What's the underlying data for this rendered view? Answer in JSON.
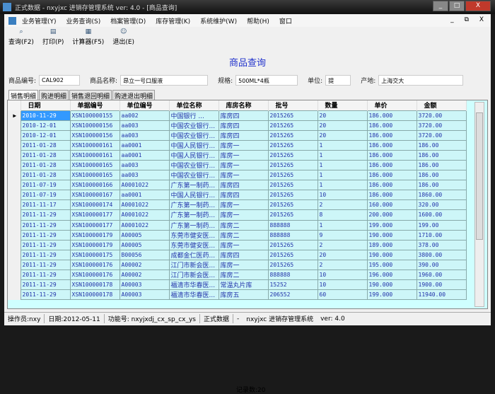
{
  "window": {
    "title": "正式数据 - nxyjxc 进销存管理系统 ver: 4.0 - [商品查询]",
    "min": "_",
    "max": "□",
    "close": "X"
  },
  "menu": [
    "业务管理(Y)",
    "业务查询(S)",
    "档案管理(D)",
    "库存管理(K)",
    "系统维护(W)",
    "帮助(H)",
    "窗口"
  ],
  "mdi_controls": "_ ⧉ X",
  "toolbar": [
    {
      "label": "查询(F2)",
      "icon": "search-icon",
      "glyph": "⌕"
    },
    {
      "label": "打印(P)",
      "icon": "printer-icon",
      "glyph": "▤"
    },
    {
      "label": "计算器(F5)",
      "icon": "calculator-icon",
      "glyph": "▦"
    },
    {
      "label": "退出(E)",
      "icon": "exit-icon",
      "glyph": "☺"
    }
  ],
  "page_title": "商品查询",
  "fields": [
    {
      "label": "商品编号:",
      "value": "CAL902"
    },
    {
      "label": "商品名称:",
      "value": "昂立一号口服液"
    },
    {
      "label": "规格:",
      "value": "500ML*4瓶"
    },
    {
      "label": "单位:",
      "value": "提"
    },
    {
      "label": "产地:",
      "value": "上海交大"
    }
  ],
  "tabs": [
    "销售明细",
    "购进明细",
    "销售退回明细",
    "购进退出明细"
  ],
  "columns": [
    "日期",
    "单据编号",
    "单位编号",
    "单位名称",
    "库房名称",
    "批号",
    "数量",
    "单价",
    "金额"
  ],
  "rows": [
    [
      "2010-11-29",
      "XSN100000155",
      "aa002",
      "中国银行      ...",
      "库房四",
      "2015265",
      "20",
      "186.000",
      "3720.00"
    ],
    [
      "2010-12-01",
      "XSN100000156",
      "aa003",
      "中国农业银行...",
      "库房四",
      "2015265",
      "20",
      "186.000",
      "3720.00"
    ],
    [
      "2010-12-01",
      "XSN100000156",
      "aa003",
      "中国农业银行...",
      "库房四",
      "2015265",
      "20",
      "186.000",
      "3720.00"
    ],
    [
      "2011-01-28",
      "XSN100000161",
      "aa0001",
      "中国人民银行...",
      "库房一",
      "2015265",
      "1",
      "186.000",
      "186.00"
    ],
    [
      "2011-01-28",
      "XSN100000161",
      "aa0001",
      "中国人民银行...",
      "库房一",
      "2015265",
      "1",
      "186.000",
      "186.00"
    ],
    [
      "2011-01-28",
      "XSN100000165",
      "aa003",
      "中国农业银行...",
      "库房一",
      "2015265",
      "1",
      "186.000",
      "186.00"
    ],
    [
      "2011-01-28",
      "XSN100000165",
      "aa003",
      "中国农业银行...",
      "库房一",
      "2015265",
      "1",
      "186.000",
      "186.00"
    ],
    [
      "2011-07-19",
      "XSN100000166",
      "A0001022",
      "广东第一制药...",
      "库房四",
      "2015265",
      "1",
      "186.000",
      "186.00"
    ],
    [
      "2011-07-19",
      "XSN100000167",
      "aa0001",
      "中国人民银行...",
      "库房四",
      "2015265",
      "10",
      "186.000",
      "1860.00"
    ],
    [
      "2011-11-17",
      "XSN100000174",
      "A0001022",
      "广东第一制药...",
      "库房一",
      "2015265",
      "2",
      "160.000",
      "320.00"
    ],
    [
      "2011-11-29",
      "XSN100000177",
      "A0001022",
      "广东第一制药...",
      "库房一",
      "2015265",
      "8",
      "200.000",
      "1600.00"
    ],
    [
      "2011-11-29",
      "XSN100000177",
      "A0001022",
      "广东第一制药...",
      "库房二",
      "888888",
      "1",
      "199.000",
      "199.00"
    ],
    [
      "2011-11-29",
      "XSN100000179",
      "A00005",
      "东莞市健安医...",
      "库房二",
      "888888",
      "9",
      "190.000",
      "1710.00"
    ],
    [
      "2011-11-29",
      "XSN100000179",
      "A00005",
      "东莞市健安医...",
      "库房一",
      "2015265",
      "2",
      "189.000",
      "378.00"
    ],
    [
      "2011-11-29",
      "XSN100000175",
      "B00056",
      "成都金仁医药...",
      "库房四",
      "2015265",
      "20",
      "190.000",
      "3800.00"
    ],
    [
      "2011-11-29",
      "XSN100000176",
      "A00002",
      "江门市新会医...",
      "库房一",
      "2015265",
      "2",
      "195.000",
      "390.00"
    ],
    [
      "2011-11-29",
      "XSN100000176",
      "A00002",
      "江门市新会医...",
      "库房二",
      "888888",
      "10",
      "196.000",
      "1960.00"
    ],
    [
      "2011-11-29",
      "XSN100000178",
      "A00003",
      "福清市华春医...",
      "常温丸片库",
      "15252",
      "10",
      "190.000",
      "1900.00"
    ],
    [
      "2011-11-29",
      "XSN100000178",
      "A00003",
      "福清市华春医...",
      "库房五",
      "206552",
      "60",
      "199.000",
      "11940.00"
    ]
  ],
  "record_count": "记录数:20",
  "status": [
    "操作员:nxy",
    "日期:2012-05-11",
    "功能号: nxyjxdj_cx_sp_cx_ys",
    "正式数据",
    "-",
    "nxyjxc 进销存管理系统",
    "ver: 4.0"
  ]
}
